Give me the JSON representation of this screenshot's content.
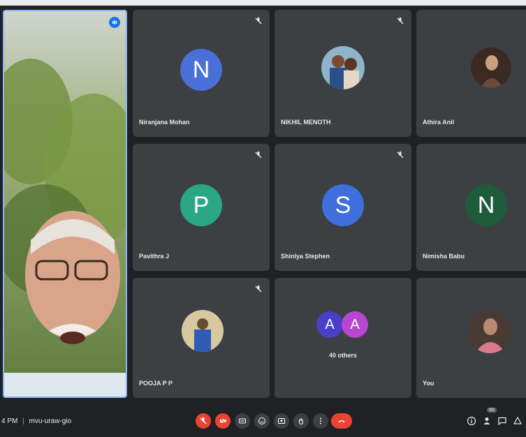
{
  "meeting": {
    "time": "4 PM",
    "separator": "|",
    "code": "mvu-uraw-gio"
  },
  "tiles": {
    "t1": {
      "name": "Niranjana Mohan",
      "initial": "N",
      "color": "#4a6fd6"
    },
    "t2": {
      "name": "NIKHIL MENOTH"
    },
    "t3": {
      "name": "Athira Anil"
    },
    "t4": {
      "name": "Pavithra J",
      "initial": "P",
      "color": "#2aa886"
    },
    "t5": {
      "name": "Shinlya Stephen",
      "initial": "S",
      "color": "#3f6fdd"
    },
    "t6": {
      "name": "Nimisha Babu",
      "initial": "N",
      "color": "#1e5b3a"
    },
    "t7": {
      "name": "POOJA P P"
    },
    "t8": {
      "others_label": "40 others",
      "initial_a": "A",
      "initial_b": "A",
      "color_a": "#4a3fc9",
      "color_b": "#b847cf"
    },
    "t9": {
      "name": "You"
    }
  },
  "controls": {
    "mic": "mic-off-icon",
    "camera": "camera-off-icon",
    "captions": "captions-icon",
    "emoji": "emoji-icon",
    "present": "present-icon",
    "hand": "raise-hand-icon",
    "more": "more-options-icon",
    "end": "end-call-icon"
  },
  "participants_badge": "50"
}
